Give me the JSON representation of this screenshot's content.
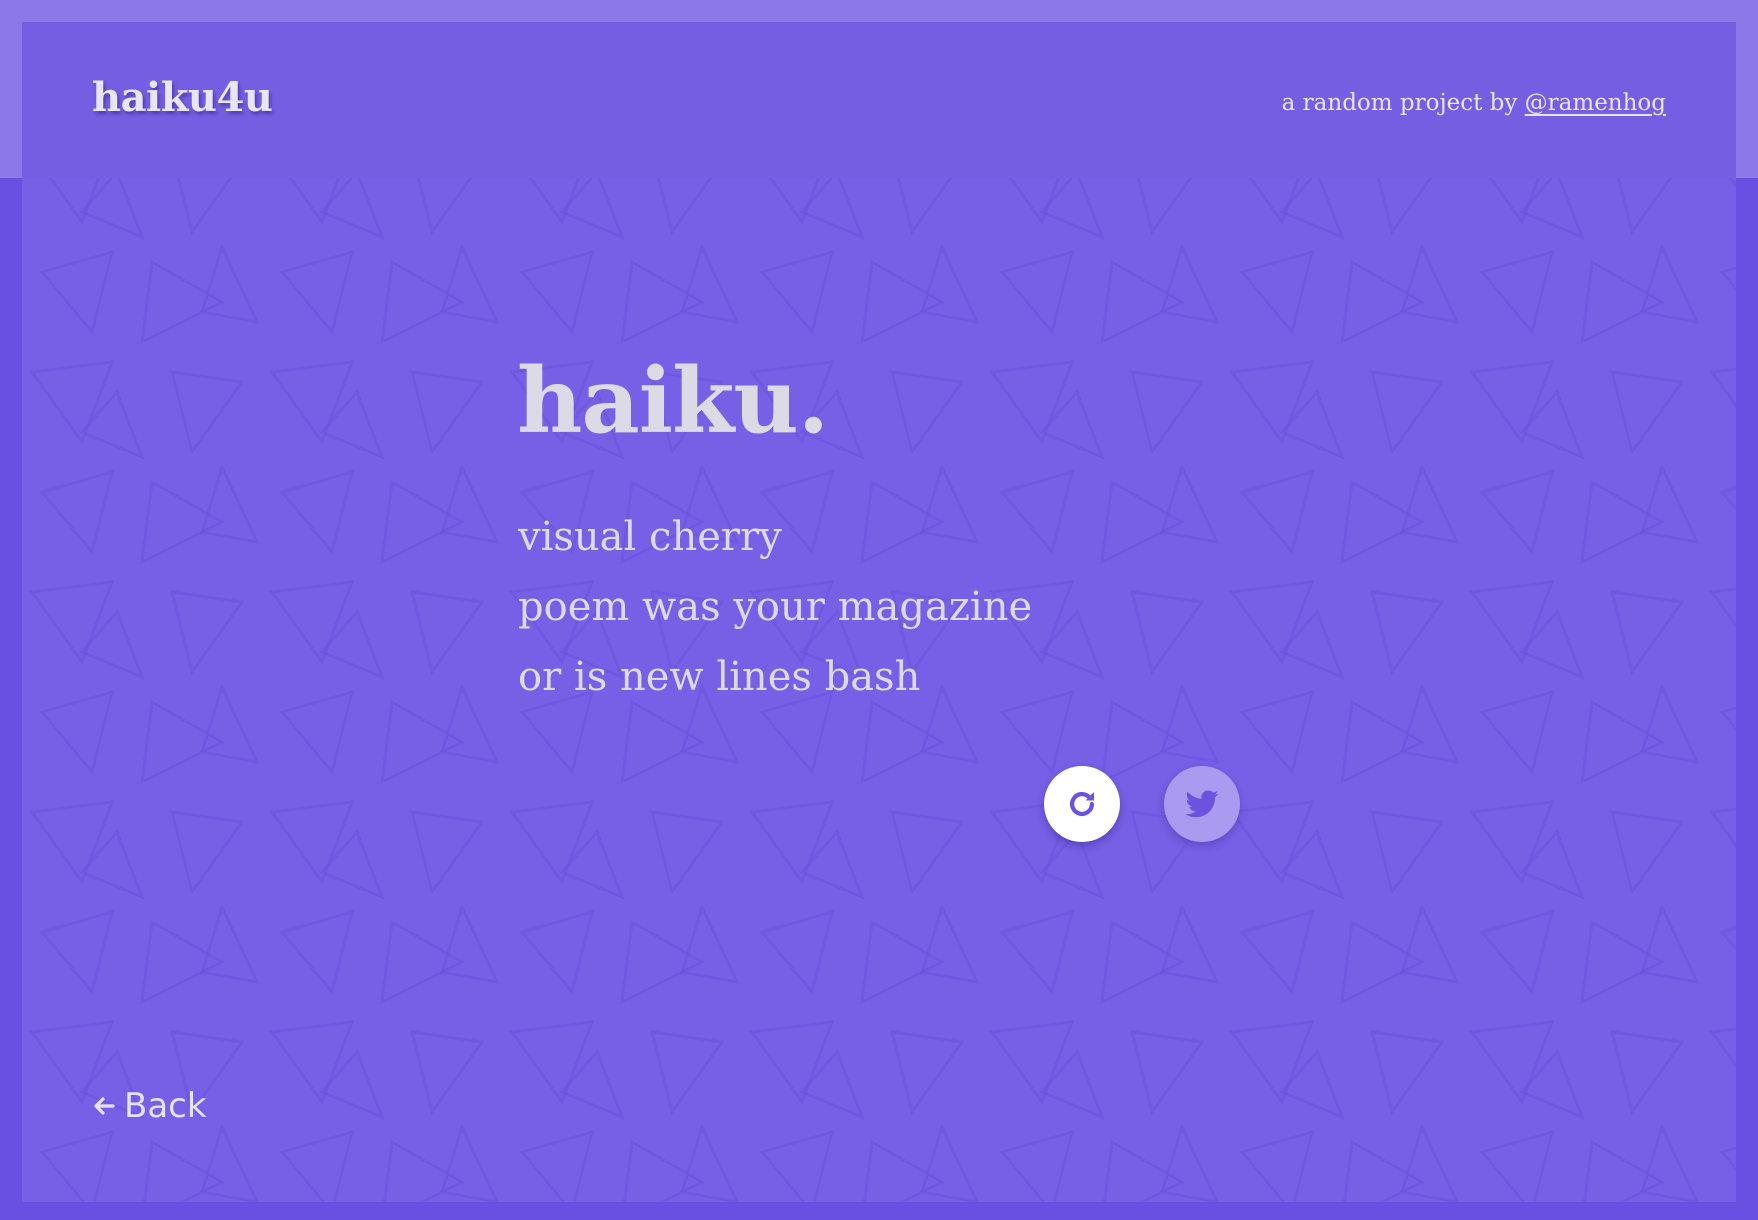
{
  "header": {
    "logo": "haiku4u",
    "credit_prefix": "a random project by",
    "credit_link": "@ramenhog"
  },
  "haiku": {
    "title": "haiku.",
    "lines": [
      "visual cherry",
      "poem was your magazine",
      "or is new lines bash"
    ]
  },
  "actions": {
    "refresh_icon": "refresh-icon",
    "twitter_icon": "twitter-icon"
  },
  "nav": {
    "back_icon": "arrow-left-icon",
    "back_label": "Back"
  },
  "colors": {
    "background": "#6a4fe3",
    "panel": "#775fe6",
    "header": "#765ee3",
    "text": "#dcdae4",
    "tweet_button": "#ab9bf0"
  }
}
